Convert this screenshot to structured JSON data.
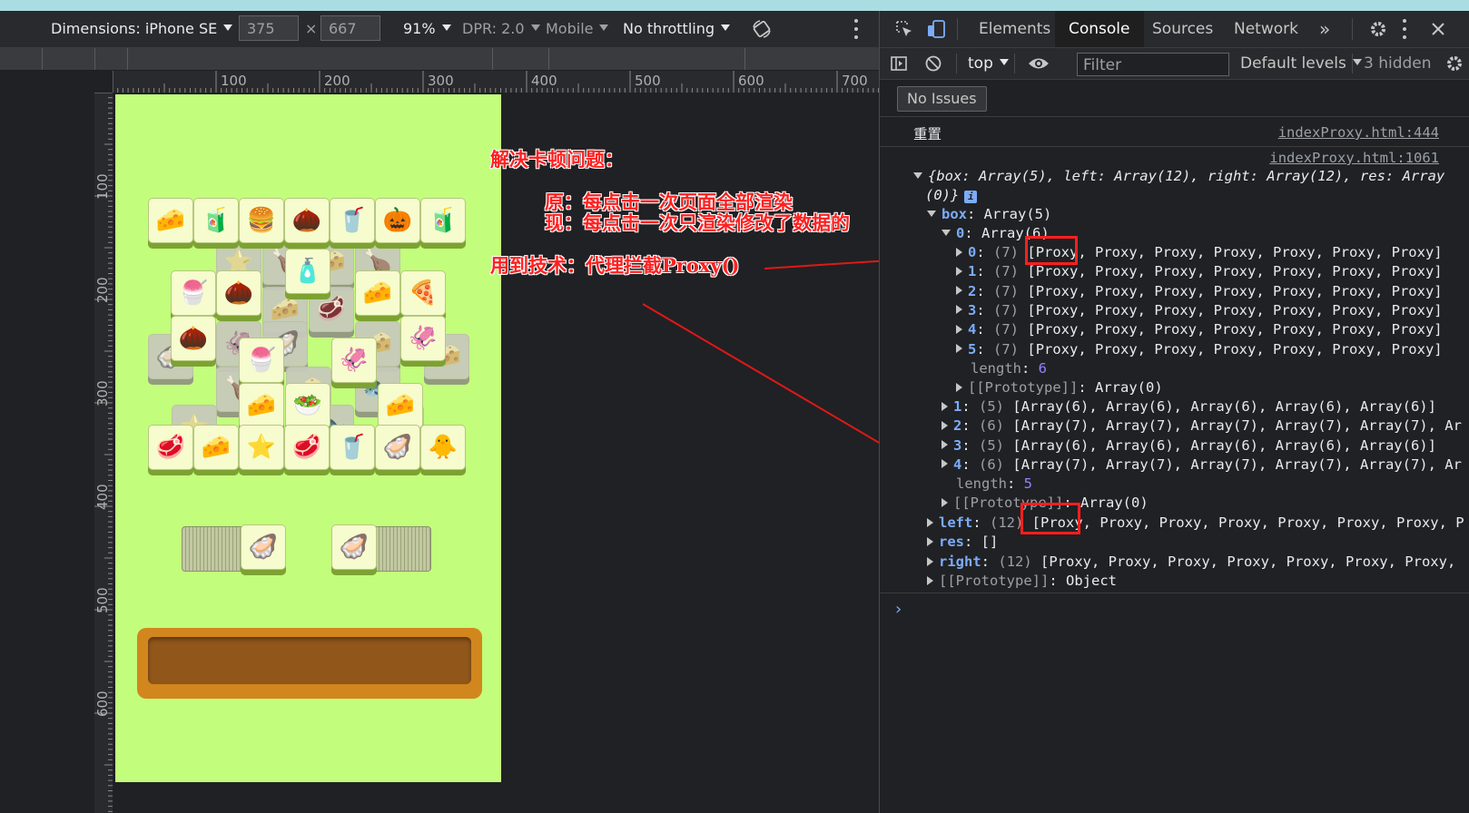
{
  "device_toolbar": {
    "dimensions_label": "Dimensions: iPhone SE",
    "width_value": "375",
    "times": "×",
    "height_value": "667",
    "zoom": "91%",
    "dpr": "DPR: 2.0",
    "mode": "Mobile",
    "throttling": "No throttling"
  },
  "ruler": {
    "top_labels": [
      "100",
      "200",
      "300",
      "400",
      "500",
      "600",
      "700"
    ],
    "left_labels": [
      "100",
      "200",
      "300",
      "400",
      "500",
      "600"
    ]
  },
  "game": {
    "background": "#c3fd7c",
    "top_row": [
      "🧀",
      "🧃",
      "🍔",
      "🌰",
      "🥤",
      "🎃",
      "🧃"
    ],
    "bottom_row": [
      "🥩",
      "🧀",
      "⭐",
      "🥩",
      "🥤",
      "🦪",
      "🐥"
    ],
    "bottle_tile": "🧴",
    "row2": [
      "🍧",
      "🌰",
      "🧀",
      "🍕"
    ],
    "row3": [
      "🌰",
      "🍧",
      "🦑",
      "🦑"
    ],
    "row4": [
      "🧀",
      "🥗",
      "🧀"
    ],
    "left_stack_tile": "🦪",
    "right_stack_tile": "🦪"
  },
  "annotations": {
    "title": "解决卡顿问题：",
    "before": "原：每点击一次页面全部渲染",
    "now": "现：每点击一次只渲染修改了数据的",
    "tech": "用到技术：代理拦截Proxy()"
  },
  "devtools": {
    "tabs": [
      "Elements",
      "Console",
      "Sources",
      "Network"
    ],
    "active_tab": "Console",
    "more_tabs": "»",
    "context": "top",
    "filter_placeholder": "Filter",
    "levels": "Default levels",
    "hidden": "3 hidden",
    "no_issues": "No Issues",
    "log1_text": "重置",
    "log1_src": "indexProxy.html:444",
    "log2_src": "indexProxy.html:1061",
    "obj_line1": "{box: Array(5), left: Array(12), right: Array(12), res: Array",
    "obj_line2": "(0)}",
    "info_badge": "i",
    "box_key": "box",
    "box_val": "Array(5)",
    "box0_key": "0",
    "box0_val": "Array(6)",
    "proxy_rows": [
      {
        "key": "0",
        "count": "(7)",
        "value": "[Proxy, Proxy, Proxy, Proxy, Proxy, Proxy, Proxy]"
      },
      {
        "key": "1",
        "count": "(7)",
        "value": "[Proxy, Proxy, Proxy, Proxy, Proxy, Proxy, Proxy]"
      },
      {
        "key": "2",
        "count": "(7)",
        "value": "[Proxy, Proxy, Proxy, Proxy, Proxy, Proxy, Proxy]"
      },
      {
        "key": "3",
        "count": "(7)",
        "value": "[Proxy, Proxy, Proxy, Proxy, Proxy, Proxy, Proxy]"
      },
      {
        "key": "4",
        "count": "(7)",
        "value": "[Proxy, Proxy, Proxy, Proxy, Proxy, Proxy, Proxy]"
      },
      {
        "key": "5",
        "count": "(7)",
        "value": "[Proxy, Proxy, Proxy, Proxy, Proxy, Proxy, Proxy]"
      }
    ],
    "length_key": "length",
    "inner_length": "6",
    "proto_key": "[[Prototype]]",
    "proto_array0": "Array(0)",
    "box_rows": [
      {
        "key": "1",
        "count": "(5)",
        "value": "[Array(6), Array(6), Array(6), Array(6), Array(6)]"
      },
      {
        "key": "2",
        "count": "(6)",
        "value": "[Array(7), Array(7), Array(7), Array(7), Array(7), Ar"
      },
      {
        "key": "3",
        "count": "(5)",
        "value": "[Array(6), Array(6), Array(6), Array(6), Array(6)]"
      },
      {
        "key": "4",
        "count": "(6)",
        "value": "[Array(7), Array(7), Array(7), Array(7), Array(7), Ar"
      }
    ],
    "outer_length": "5",
    "left_key": "left",
    "left_count": "(12)",
    "left_val": "[Proxy, Proxy, Proxy, Proxy, Proxy, Proxy, Proxy, P",
    "res_key": "res",
    "res_val": "[]",
    "right_key": "right",
    "right_count": "(12)",
    "right_val": "[Proxy, Proxy, Proxy, Proxy, Proxy, Proxy, Proxy,",
    "object_proto": "Object",
    "prompt": "›"
  }
}
